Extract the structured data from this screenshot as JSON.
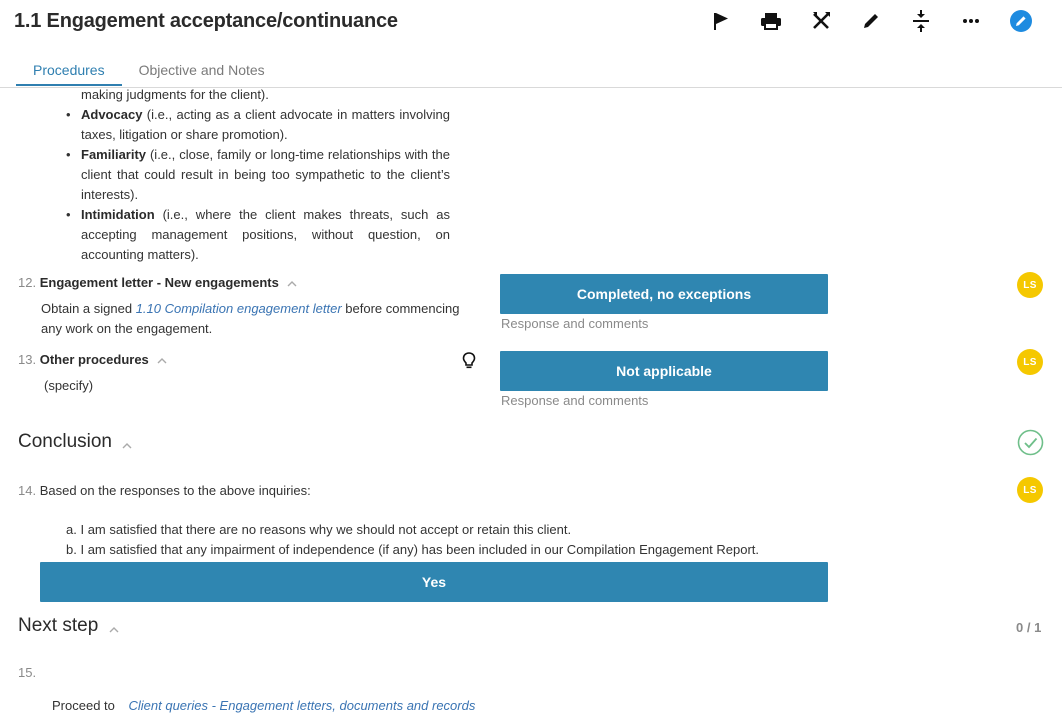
{
  "header": {
    "title": "1.1 Engagement acceptance/continuance",
    "toolbar_icons": [
      "flag-icon",
      "print-icon",
      "tools-icon",
      "pencil-icon",
      "collapse-icon",
      "more-icon",
      "edit-circle-icon"
    ]
  },
  "tabs": [
    {
      "label": "Procedures",
      "active": true
    },
    {
      "label": "Objective and Notes",
      "active": false
    }
  ],
  "threats": {
    "continuation": "making judgments for the client).",
    "items": [
      {
        "term": "Advocacy",
        "text": " (i.e., acting as a client advocate in matters involving taxes, litigation or share promotion)."
      },
      {
        "term": "Familiarity",
        "text": " (i.e., close, family or long-time relationships with the client that could result in being too sympathetic to the client’s interests)."
      },
      {
        "term": "Intimidation",
        "text": " (i.e., where the client makes threats, such as accepting management positions, without question, on accounting matters)."
      }
    ]
  },
  "procedures": [
    {
      "number": "12.",
      "title": "Engagement letter - New engagements",
      "text_before": "Obtain a signed ",
      "link": "1.10 Compilation engagement letter",
      "text_after": " before commencing any work on the engagement.",
      "response": "Completed, no exceptions",
      "comment_placeholder": "Response and comments",
      "avatar": "LS"
    },
    {
      "number": "13.",
      "title": "Other procedures",
      "text": "(specify)",
      "response": "Not applicable",
      "comment_placeholder": "Response and comments",
      "avatar": "LS",
      "hint_icon": "lightbulb-icon"
    }
  ],
  "conclusion": {
    "heading": "Conclusion",
    "status_icon": "check-circle-icon",
    "number": "14.",
    "question": "Based on the responses to the above inquiries:",
    "points": [
      {
        "marker": "a.",
        "text": "I am satisfied that there are no reasons why we should not accept or retain this client."
      },
      {
        "marker": "b.",
        "text": "I am satisfied that any impairment of independence (if any) has been included in our Compilation Engagement Report."
      }
    ],
    "response": "Yes",
    "avatar": "LS"
  },
  "next_step": {
    "heading": "Next step",
    "counter": "0 / 1",
    "number": "15.",
    "label": "Proceed to",
    "link": "Client queries - Engagement letters, documents and records"
  },
  "colors": {
    "accent": "#2f86b1",
    "tab_active": "#2f7fb0",
    "avatar": "#f5c800",
    "link": "#3a74b3",
    "check": "#6fbf8a"
  }
}
